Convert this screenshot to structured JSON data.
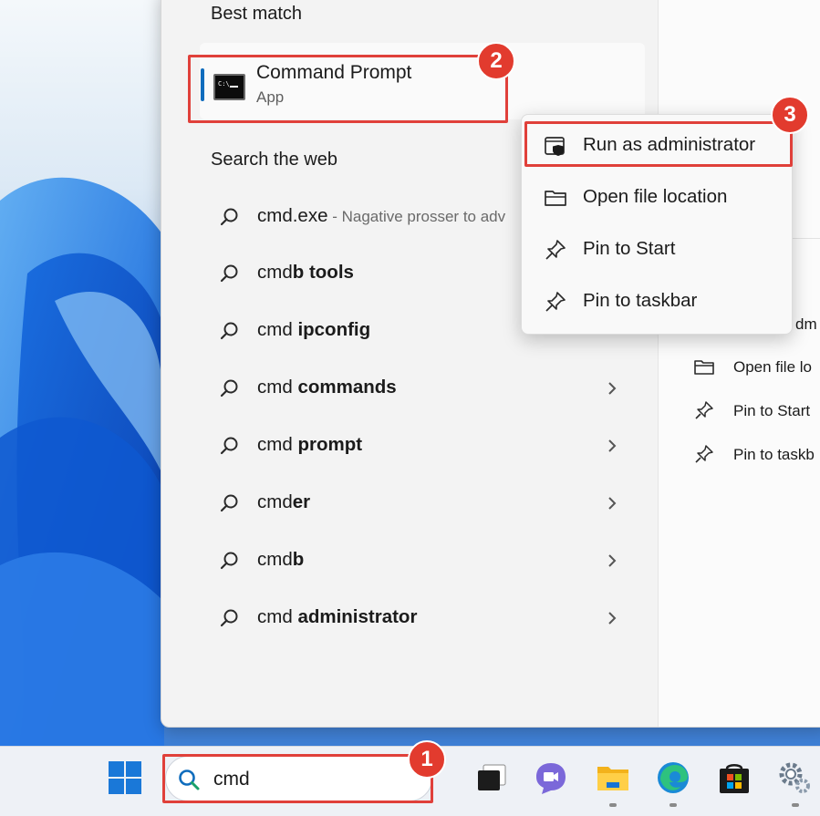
{
  "best_match": {
    "title": "Best match",
    "app_name": "Command Prompt",
    "app_type": "App",
    "icon_text": "C:\\_"
  },
  "web": {
    "title": "Search the web",
    "items": [
      {
        "prefix": "cmd.exe",
        "bold": "",
        "desc": " - Nagative prosser to adv",
        "chevron": false
      },
      {
        "prefix": "cmd",
        "bold": "b tools",
        "desc": "",
        "chevron": false
      },
      {
        "prefix": "cmd ",
        "bold": "ipconfig",
        "desc": "",
        "chevron": false
      },
      {
        "prefix": "cmd ",
        "bold": "commands",
        "desc": "",
        "chevron": true
      },
      {
        "prefix": "cmd ",
        "bold": "prompt",
        "desc": "",
        "chevron": true
      },
      {
        "prefix": "cmd",
        "bold": "er",
        "desc": "",
        "chevron": true
      },
      {
        "prefix": "cmd",
        "bold": "b",
        "desc": "",
        "chevron": true
      },
      {
        "prefix": "cmd ",
        "bold": "administrator",
        "desc": "",
        "chevron": true
      }
    ]
  },
  "context_menu": {
    "items": [
      {
        "label": "Run as administrator",
        "icon": "shield-window-icon"
      },
      {
        "label": "Open file location",
        "icon": "folder-icon"
      },
      {
        "label": "Pin to Start",
        "icon": "pin-icon"
      },
      {
        "label": "Pin to taskbar",
        "icon": "pin-icon"
      }
    ]
  },
  "right_pane": {
    "partial_item": "dm",
    "items": [
      "Open file lo",
      "Pin to Start",
      "Pin to taskb"
    ]
  },
  "taskbar": {
    "search_value": "cmd",
    "apps": [
      "start-icon",
      "task-view-icon",
      "teams-chat-icon",
      "file-explorer-icon",
      "edge-icon",
      "store-icon",
      "settings-icon"
    ]
  },
  "steps": [
    "1",
    "2",
    "3"
  ],
  "colors": {
    "highlight": "#e0403a",
    "badge": "#e23b2e",
    "accent": "#0f6cbd"
  }
}
